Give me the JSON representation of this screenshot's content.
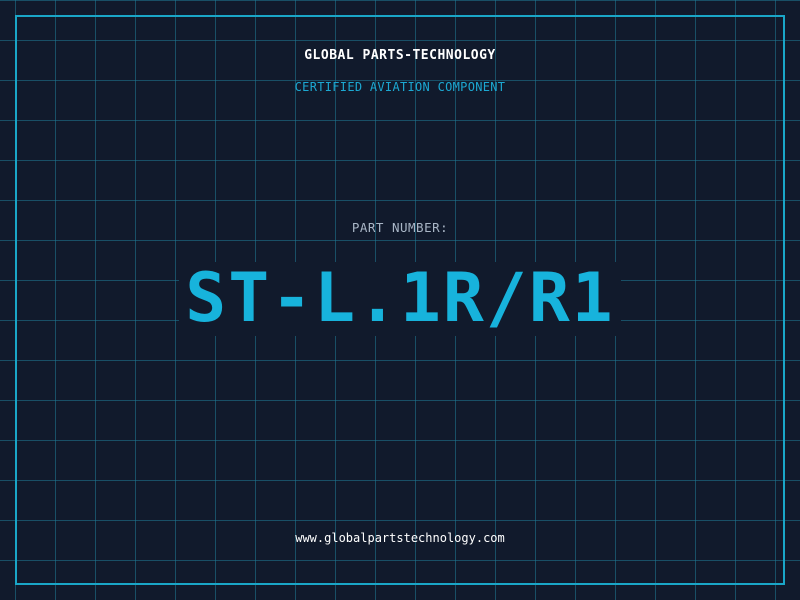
{
  "header": {
    "company": "GLOBAL PARTS-TECHNOLOGY",
    "tagline": "CERTIFIED AVIATION COMPONENT"
  },
  "part": {
    "label": "PART NUMBER:",
    "number": "ST-L.1R/R1"
  },
  "footer": {
    "website": "www.globalpartstechnology.com"
  },
  "colors": {
    "background": "#111a2c",
    "accent": "#17b3dc",
    "grid": "#1f7a96",
    "frame": "#1aa6c8"
  }
}
